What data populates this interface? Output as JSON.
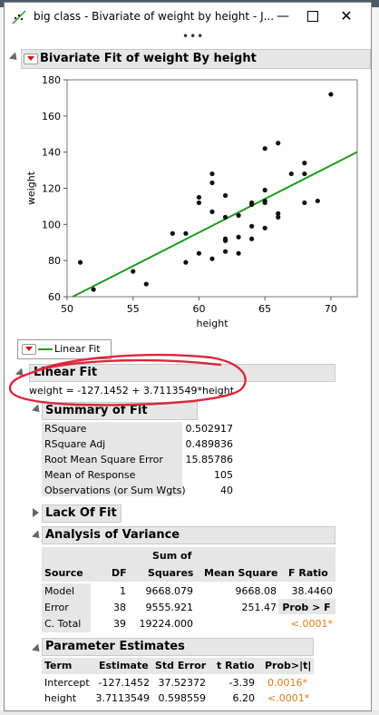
{
  "window": {
    "title": "big class - Bivariate of weight by height - J..."
  },
  "report": {
    "title": "Bivariate Fit of weight By height",
    "linear_fit_legend": "Linear Fit",
    "linear_fit_header": "Linear Fit",
    "equation": "weight = -127.1452 + 3.7113549*height"
  },
  "chart_data": {
    "type": "scatter",
    "xlabel": "height",
    "ylabel": "weight",
    "xlim": [
      50,
      72
    ],
    "ylim": [
      60,
      180
    ],
    "xticks": [
      50,
      55,
      60,
      65,
      70
    ],
    "yticks": [
      60,
      80,
      100,
      120,
      140,
      160,
      180
    ],
    "points": [
      [
        51,
        79
      ],
      [
        52,
        64
      ],
      [
        55,
        74
      ],
      [
        56,
        67
      ],
      [
        58,
        95
      ],
      [
        59,
        95
      ],
      [
        59,
        79
      ],
      [
        60,
        115
      ],
      [
        60,
        112
      ],
      [
        60,
        84
      ],
      [
        61,
        128
      ],
      [
        61,
        123
      ],
      [
        61,
        107
      ],
      [
        61,
        81
      ],
      [
        62,
        116
      ],
      [
        62,
        104
      ],
      [
        62,
        92
      ],
      [
        62,
        91
      ],
      [
        62,
        85
      ],
      [
        63,
        105
      ],
      [
        63,
        93
      ],
      [
        63,
        84
      ],
      [
        64,
        112
      ],
      [
        64,
        99
      ],
      [
        64,
        92
      ],
      [
        65,
        142
      ],
      [
        65,
        119
      ],
      [
        65,
        112
      ],
      [
        65,
        98
      ],
      [
        66,
        145
      ],
      [
        66,
        106
      ],
      [
        66,
        104
      ],
      [
        67,
        128
      ],
      [
        68,
        134
      ],
      [
        68,
        128
      ],
      [
        68,
        112
      ],
      [
        69,
        113
      ],
      [
        70,
        172
      ],
      [
        64,
        111
      ],
      [
        65,
        113
      ]
    ],
    "fit": {
      "intercept": -127.1452,
      "slope": 3.7113549,
      "color": "#1f9a1f"
    }
  },
  "summary": {
    "title": "Summary of Fit",
    "rows": [
      {
        "label": "RSquare",
        "value": "0.502917"
      },
      {
        "label": "RSquare Adj",
        "value": "0.489836"
      },
      {
        "label": "Root Mean Square Error",
        "value": "15.85786"
      },
      {
        "label": "Mean of Response",
        "value": "105"
      },
      {
        "label": "Observations (or Sum Wgts)",
        "value": "40"
      }
    ]
  },
  "lack_of_fit": {
    "title": "Lack Of Fit"
  },
  "anova": {
    "title": "Analysis of Variance",
    "headers": {
      "source": "Source",
      "df": "DF",
      "ss_top": "Sum of",
      "ss_bottom": "Squares",
      "ms": "Mean Square",
      "f": "F Ratio"
    },
    "rows": [
      {
        "source": "Model",
        "df": "1",
        "ss": "9668.079",
        "ms": "9668.08",
        "f": "38.4460"
      },
      {
        "source": "Error",
        "df": "38",
        "ss": "9555.921",
        "ms": "251.47",
        "f": "Prob > F"
      },
      {
        "source": "C. Total",
        "df": "39",
        "ss": "19224.000",
        "ms": "",
        "f": "<.0001*"
      }
    ]
  },
  "params": {
    "title": "Parameter Estimates",
    "headers": {
      "term": "Term",
      "est": "Estimate",
      "se": "Std Error",
      "t": "t Ratio",
      "p": "Prob>|t|"
    },
    "rows": [
      {
        "term": "Intercept",
        "est": "-127.1452",
        "se": "37.52372",
        "t": "-3.39",
        "p": "0.0016*"
      },
      {
        "term": "height",
        "est": "3.7113549",
        "se": "0.598559",
        "t": "6.20",
        "p": "<.0001*"
      }
    ]
  },
  "colors": {
    "significant": "#e07a1a",
    "annotation": "#d8283c"
  }
}
